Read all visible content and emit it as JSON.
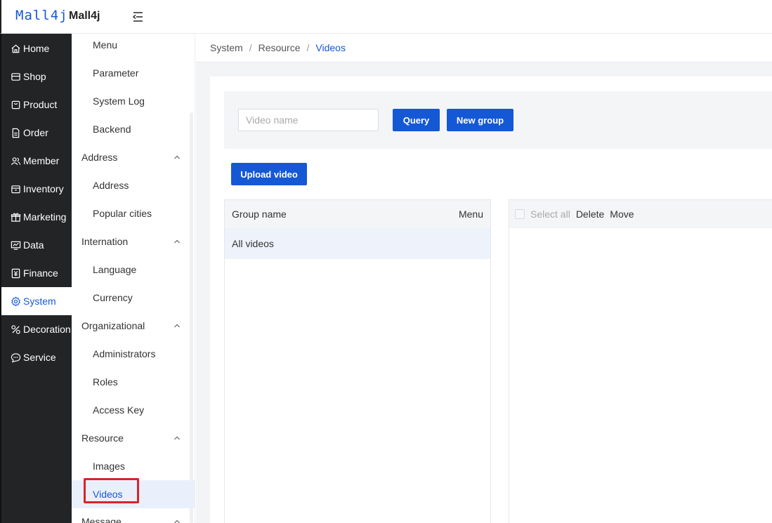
{
  "header": {
    "logo_text": "Mall4j",
    "brand": "Mall4j"
  },
  "nav": {
    "items": [
      {
        "label": "Home",
        "icon": "home-icon"
      },
      {
        "label": "Shop",
        "icon": "shop-icon"
      },
      {
        "label": "Product",
        "icon": "product-icon"
      },
      {
        "label": "Order",
        "icon": "order-icon"
      },
      {
        "label": "Member",
        "icon": "member-icon"
      },
      {
        "label": "Inventory",
        "icon": "inventory-icon"
      },
      {
        "label": "Marketing",
        "icon": "gift-icon"
      },
      {
        "label": "Data",
        "icon": "chart-icon"
      },
      {
        "label": "Finance",
        "icon": "finance-icon"
      },
      {
        "label": "System",
        "icon": "gear-icon",
        "active": true
      },
      {
        "label": "Decoration",
        "icon": "decoration-icon"
      },
      {
        "label": "Service",
        "icon": "chat-icon"
      }
    ]
  },
  "subnav": {
    "menu": "Menu",
    "parameter": "Parameter",
    "system_log": "System Log",
    "backend": "Backend",
    "address_group": "Address",
    "address": "Address",
    "popular_cities": "Popular cities",
    "internation_group": "Internation",
    "language": "Language",
    "currency": "Currency",
    "organizational_group": "Organizational",
    "administrators": "Administrators",
    "roles": "Roles",
    "access_key": "Access Key",
    "resource_group": "Resource",
    "images": "Images",
    "videos": "Videos",
    "message_group": "Message"
  },
  "breadcrumb": {
    "level1": "System",
    "level2": "Resource",
    "current": "Videos",
    "separator": "/"
  },
  "search": {
    "placeholder": "Video name",
    "value": "",
    "query_label": "Query",
    "new_group_label": "New group"
  },
  "upload_label": "Upload video",
  "groups": {
    "header_name": "Group name",
    "header_menu": "Menu",
    "rows": [
      "All videos"
    ]
  },
  "videos": {
    "select_all": "Select all",
    "delete": "Delete",
    "move": "Move"
  },
  "colors": {
    "accent": "#1558d6",
    "sidebar": "#222426",
    "highlight_border": "#d9232b"
  }
}
